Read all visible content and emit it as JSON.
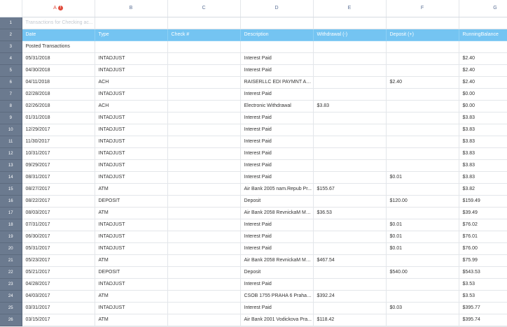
{
  "columns": [
    {
      "key": "A",
      "label": "A",
      "warning": true
    },
    {
      "key": "B",
      "label": "B"
    },
    {
      "key": "C",
      "label": "C"
    },
    {
      "key": "D",
      "label": "D"
    },
    {
      "key": "E",
      "label": "E"
    },
    {
      "key": "F",
      "label": "F"
    },
    {
      "key": "G",
      "label": "G"
    }
  ],
  "warning_glyph": "!",
  "title_row": {
    "num": "1",
    "text": "Transactions for Checking ac..."
  },
  "header_row": {
    "num": "2",
    "cells": [
      "Date",
      "Type",
      "Check #",
      "Description",
      "Withdrawal (-)",
      "Deposit (+)",
      "RunningBalance"
    ]
  },
  "section_row": {
    "num": "3",
    "text": "Posted Transactions"
  },
  "rows": [
    {
      "num": "4",
      "cells": [
        "05/31/2018",
        "INTADJUST",
        "",
        "Interest Paid",
        "",
        "",
        "$2.40"
      ]
    },
    {
      "num": "5",
      "cells": [
        "04/30/2018",
        "INTADJUST",
        "",
        "Interest Paid",
        "",
        "",
        "$2.40"
      ]
    },
    {
      "num": "6",
      "cells": [
        "04/11/2018",
        "ACH",
        "",
        "RAISERLLC EDI PAYMNT AP...",
        "",
        "$2.40",
        "$2.40"
      ]
    },
    {
      "num": "7",
      "cells": [
        "02/28/2018",
        "INTADJUST",
        "",
        "Interest Paid",
        "",
        "",
        "$0.00"
      ]
    },
    {
      "num": "8",
      "cells": [
        "02/26/2018",
        "ACH",
        "",
        "Electronic Withdrawal",
        "$3.83",
        "",
        "$0.00"
      ]
    },
    {
      "num": "9",
      "cells": [
        "01/31/2018",
        "INTADJUST",
        "",
        "Interest Paid",
        "",
        "",
        "$3.83"
      ]
    },
    {
      "num": "10",
      "cells": [
        "12/29/2017",
        "INTADJUST",
        "",
        "Interest Paid",
        "",
        "",
        "$3.83"
      ]
    },
    {
      "num": "11",
      "cells": [
        "11/30/2017",
        "INTADJUST",
        "",
        "Interest Paid",
        "",
        "",
        "$3.83"
      ]
    },
    {
      "num": "12",
      "cells": [
        "10/31/2017",
        "INTADJUST",
        "",
        "Interest Paid",
        "",
        "",
        "$3.83"
      ]
    },
    {
      "num": "13",
      "cells": [
        "09/29/2017",
        "INTADJUST",
        "",
        "Interest Paid",
        "",
        "",
        "$3.83"
      ]
    },
    {
      "num": "14",
      "cells": [
        "08/31/2017",
        "INTADJUST",
        "",
        "Interest Paid",
        "",
        "$0.01",
        "$3.83"
      ]
    },
    {
      "num": "15",
      "cells": [
        "08/27/2017",
        "ATM",
        "",
        "Air Bank 2005 nam.Repub Pr...",
        "$155.67",
        "",
        "$3.82"
      ]
    },
    {
      "num": "16",
      "cells": [
        "08/22/2017",
        "DEPOSIT",
        "",
        "Deposit",
        "",
        "$120.00",
        "$159.49"
      ]
    },
    {
      "num": "17",
      "cells": [
        "08/03/2017",
        "ATM",
        "",
        "Air Bank 2058 RevnickaM Me...",
        "$36.53",
        "",
        "$39.49"
      ]
    },
    {
      "num": "18",
      "cells": [
        "07/31/2017",
        "INTADJUST",
        "",
        "Interest Paid",
        "",
        "$0.01",
        "$76.02"
      ]
    },
    {
      "num": "19",
      "cells": [
        "06/30/2017",
        "INTADJUST",
        "",
        "Interest Paid",
        "",
        "$0.01",
        "$76.01"
      ]
    },
    {
      "num": "20",
      "cells": [
        "05/31/2017",
        "INTADJUST",
        "",
        "Interest Paid",
        "",
        "$0.01",
        "$76.00"
      ]
    },
    {
      "num": "21",
      "cells": [
        "05/23/2017",
        "ATM",
        "",
        "Air Bank 2058 RevnickaM Me...",
        "$467.54",
        "",
        "$75.99"
      ]
    },
    {
      "num": "22",
      "cells": [
        "05/21/2017",
        "DEPOSIT",
        "",
        "Deposit",
        "",
        "$540.00",
        "$543.53"
      ]
    },
    {
      "num": "23",
      "cells": [
        "04/28/2017",
        "INTADJUST",
        "",
        "Interest Paid",
        "",
        "",
        "$3.53"
      ]
    },
    {
      "num": "24",
      "cells": [
        "04/03/2017",
        "ATM",
        "",
        "CSOB 1755 PRAHA 6 Praha 1...",
        "$392.24",
        "",
        "$3.53"
      ]
    },
    {
      "num": "25",
      "cells": [
        "03/31/2017",
        "INTADJUST",
        "",
        "Interest Paid",
        "",
        "$0.03",
        "$395.77"
      ]
    },
    {
      "num": "26",
      "cells": [
        "03/15/2017",
        "ATM",
        "",
        "Air Bank 2001 Vodickova Pra...",
        "$118.42",
        "",
        "$395.74"
      ]
    }
  ]
}
